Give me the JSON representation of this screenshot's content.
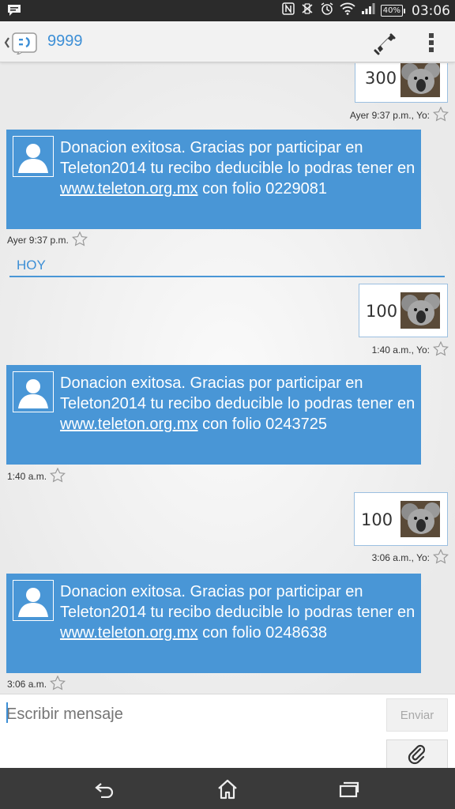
{
  "status_bar": {
    "battery": "40%",
    "time": "03:06",
    "icons": [
      "notification-bubble-icon",
      "nfc-icon",
      "vibrate-icon",
      "alarm-icon",
      "wifi-icon",
      "signal-icon",
      "battery-icon"
    ]
  },
  "app_bar": {
    "title": "9999",
    "icons": [
      "back-icon",
      "messaging-app-icon",
      "phone-icon",
      "overflow-menu-icon"
    ]
  },
  "conversation": {
    "day_separator": "HOY",
    "messages": [
      {
        "direction": "sent",
        "amount": "300",
        "meta": "Ayer 9:37 p.m., Yo:"
      },
      {
        "direction": "received",
        "text_before": "Donacion exitosa. Gracias por participar en Teleton2014 tu recibo deducible lo podras tener en ",
        "link": "www.teleton.org.mx",
        "text_after": " con folio 0229081",
        "meta": "Ayer 9:37 p.m."
      },
      {
        "direction": "sent",
        "amount": "100",
        "meta": "1:40 a.m., Yo:"
      },
      {
        "direction": "received",
        "text_before": "Donacion exitosa. Gracias por participar en Teleton2014 tu recibo deducible lo podras tener en ",
        "link": "www.teleton.org.mx",
        "text_after": " con folio 0243725",
        "meta": "1:40 a.m."
      },
      {
        "direction": "sent",
        "amount": "100",
        "meta": "3:06 a.m., Yo:"
      },
      {
        "direction": "received",
        "text_before": "Donacion exitosa. Gracias por participar en Teleton2014 tu recibo deducible lo podras tener en ",
        "link": "www.teleton.org.mx",
        "text_after": " con folio 0248638",
        "meta": "3:06 a.m."
      }
    ]
  },
  "composer": {
    "placeholder": "Escribir mensaje",
    "value": "",
    "send_label": "Enviar",
    "attach_icon": "paperclip-icon"
  },
  "nav_bar": {
    "icons": [
      "nav-back-icon",
      "home-icon",
      "recent-apps-icon"
    ]
  },
  "colors": {
    "accent": "#3d8fd6",
    "received_bubble": "#4996d6",
    "sent_border": "#9bbfe0",
    "status_bar_bg": "#2b2b2b",
    "nav_bar_bg": "#3a3a3a"
  }
}
